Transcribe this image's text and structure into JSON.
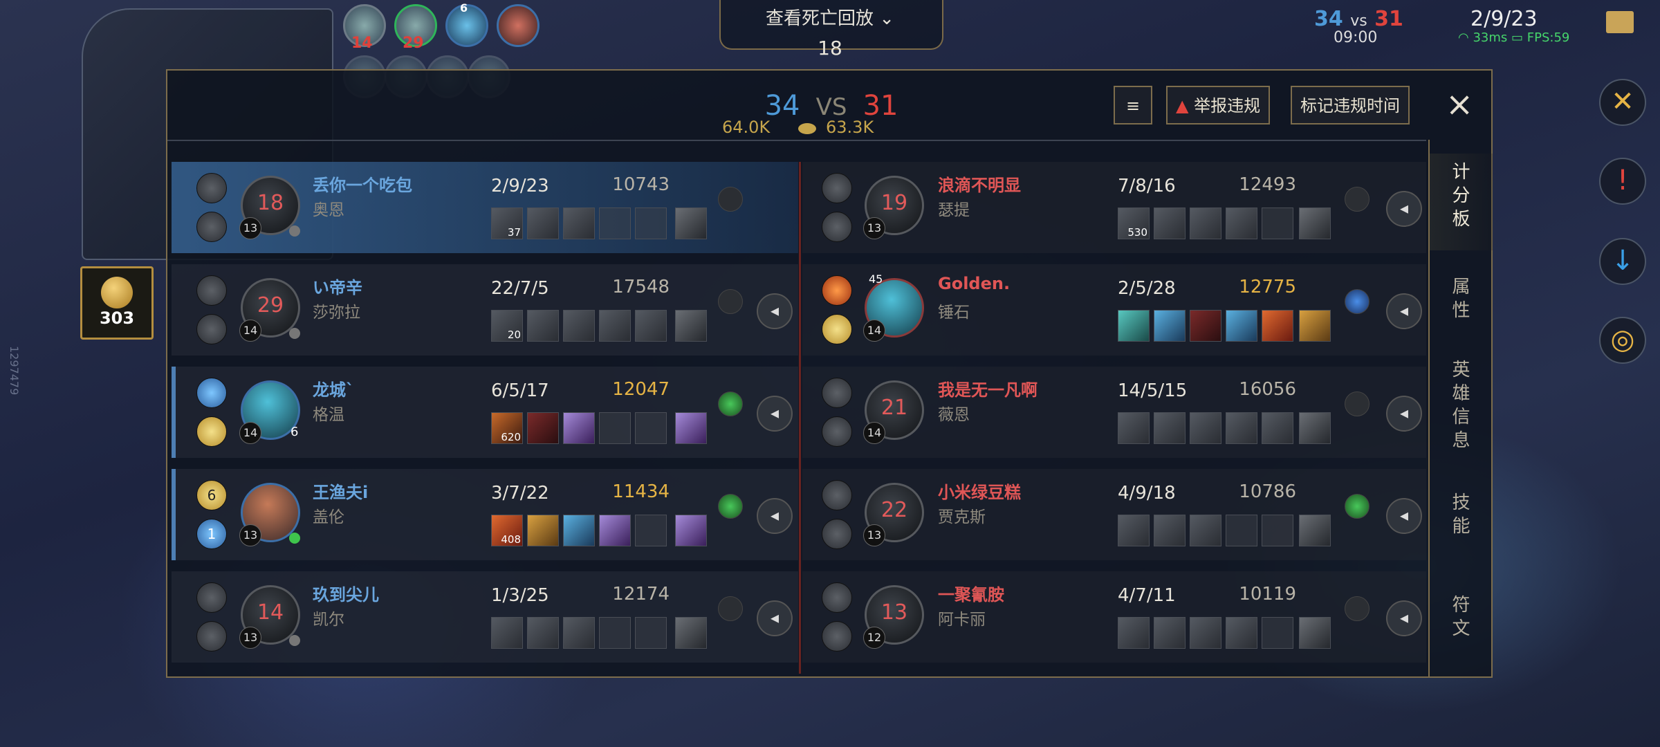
{
  "top_hud": {
    "replay_label": "查看死亡回放",
    "respawn": "18",
    "score_blue": "34",
    "vs": "vs",
    "score_red": "31",
    "game_time": "09:00",
    "kda": "2/9/23",
    "ping": "33ms",
    "fps": "FPS:59",
    "gold": "303",
    "side_id": "1297479"
  },
  "ally_heads": {
    "h1_num": "14",
    "h2_num": "29",
    "h3_num": "6"
  },
  "enemy_heads": {
    "e1": "19",
    "e2": "21",
    "e3": "22",
    "e4": "13"
  },
  "panel": {
    "blue_score": "34",
    "vs": "VS",
    "red_score": "31",
    "blue_gold": "64.0K",
    "red_gold": "63.3K",
    "report_button": "举报违规",
    "mark_button": "标记违规时间",
    "close_icon": "×",
    "tabs": [
      {
        "label": "计\n分\n板"
      },
      {
        "label": "属\n性"
      },
      {
        "label": "英\n雄\n信\n息"
      },
      {
        "label": "技\n能"
      },
      {
        "label": "符\n文"
      }
    ]
  },
  "blue_team": [
    {
      "name": "丢你一个吃包",
      "champion": "奥恩",
      "kda": "2/9/23",
      "gold": "10743",
      "dead_timer": "18",
      "level": "13",
      "item_count": "37"
    },
    {
      "name": "い帝辛",
      "champion": "莎弥拉",
      "kda": "22/7/5",
      "gold": "17548",
      "dead_timer": "29",
      "level": "14",
      "item_count": "20"
    },
    {
      "name": "龙城`",
      "champion": "格温",
      "kda": "6/5/17",
      "gold": "12047",
      "dead_timer": "",
      "level": "14",
      "item_count": "620",
      "stacks": "6"
    },
    {
      "name": "王渔夫i",
      "champion": "盖伦",
      "kda": "3/7/22",
      "gold": "11434",
      "dead_timer": "",
      "level": "13",
      "item_count": "408",
      "spell_badge_1": "6",
      "spell_badge_2": "1"
    },
    {
      "name": "玖到尖儿",
      "champion": "凯尔",
      "kda": "1/3/25",
      "gold": "12174",
      "dead_timer": "14",
      "level": "13",
      "item_count": ""
    }
  ],
  "red_team": [
    {
      "name": "浪滴不明显",
      "champion": "瑟提",
      "kda": "7/8/16",
      "gold": "12493",
      "dead_timer": "19",
      "level": "13",
      "item_count": "530"
    },
    {
      "name": "Golden.",
      "champion": "锤石",
      "kda": "2/5/28",
      "gold": "12775",
      "dead_timer": "",
      "level": "14",
      "item_count": "",
      "stacks": "45"
    },
    {
      "name": "我是无一凡啊",
      "champion": "薇恩",
      "kda": "14/5/15",
      "gold": "16056",
      "dead_timer": "21",
      "level": "14",
      "item_count": ""
    },
    {
      "name": "小米绿豆糕",
      "champion": "贾克斯",
      "kda": "4/9/18",
      "gold": "10786",
      "dead_timer": "22",
      "level": "13",
      "item_count": ""
    },
    {
      "name": "一聚氰胺",
      "champion": "阿卡丽",
      "kda": "4/7/11",
      "gold": "10119",
      "dead_timer": "13",
      "level": "12",
      "item_count": ""
    }
  ],
  "colors": {
    "blue": "#4e9ad8",
    "red": "#e0443d",
    "gold": "#e6b445",
    "frame": "#7d6d4c"
  }
}
